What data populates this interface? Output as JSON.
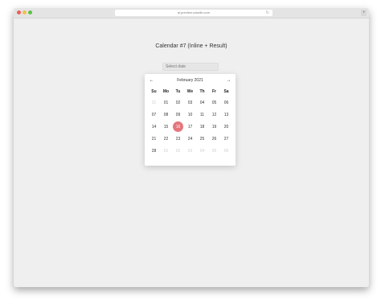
{
  "browser": {
    "url": "ai.preview.colorlib.com"
  },
  "page": {
    "title": "Calendar #7 (Inline + Result)"
  },
  "date_input": {
    "placeholder": "Select date"
  },
  "calendar": {
    "month_label": "February 2021",
    "prev_icon": "←",
    "next_icon": "→",
    "weekdays": [
      "Su",
      "Mo",
      "Tu",
      "We",
      "Th",
      "Fr",
      "Sa"
    ],
    "weeks": [
      [
        "31",
        "01",
        "02",
        "03",
        "04",
        "05",
        "06"
      ],
      [
        "07",
        "08",
        "09",
        "10",
        "11",
        "12",
        "13"
      ],
      [
        "14",
        "15",
        "16",
        "17",
        "18",
        "19",
        "20"
      ],
      [
        "21",
        "22",
        "23",
        "24",
        "25",
        "26",
        "27"
      ],
      [
        "28",
        "01",
        "02",
        "03",
        "04",
        "05",
        "06"
      ]
    ],
    "selected_day": "16",
    "accent_color": "#e4767c"
  }
}
